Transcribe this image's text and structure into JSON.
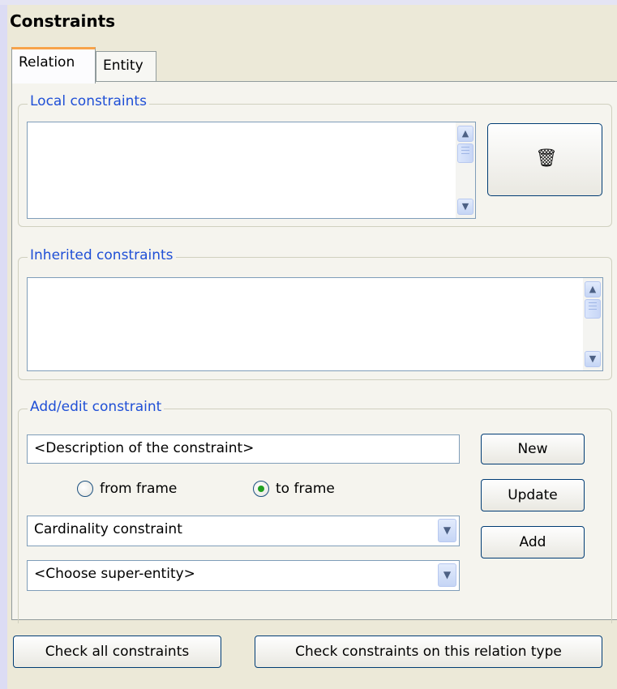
{
  "window": {
    "title": "Constraints"
  },
  "tabs": [
    {
      "label": "Relation",
      "active": true
    },
    {
      "label": "Entity",
      "active": false
    }
  ],
  "local_constraints": {
    "legend": "Local constraints",
    "items": [],
    "delete_icon": "trash-icon",
    "delete_glyph": "🗑"
  },
  "inherited_constraints": {
    "legend": "Inherited constraints",
    "items": []
  },
  "add_edit": {
    "legend": "Add/edit constraint",
    "description_value": "<Description of the constraint>",
    "radio_from_label": "from frame",
    "radio_to_label": "to frame",
    "selected_radio": "to frame",
    "constraint_type_value": "Cardinality constraint",
    "super_entity_value": "<Choose super-entity>",
    "new_label": "New",
    "update_label": "Update",
    "add_label": "Add"
  },
  "footer": {
    "check_all_label": "Check all constraints",
    "check_relation_label": "Check constraints on this relation type"
  },
  "colors": {
    "legend": "#1f4fd6",
    "tab_highlight": "#f7a34a",
    "radio_selected": "#21a121"
  }
}
